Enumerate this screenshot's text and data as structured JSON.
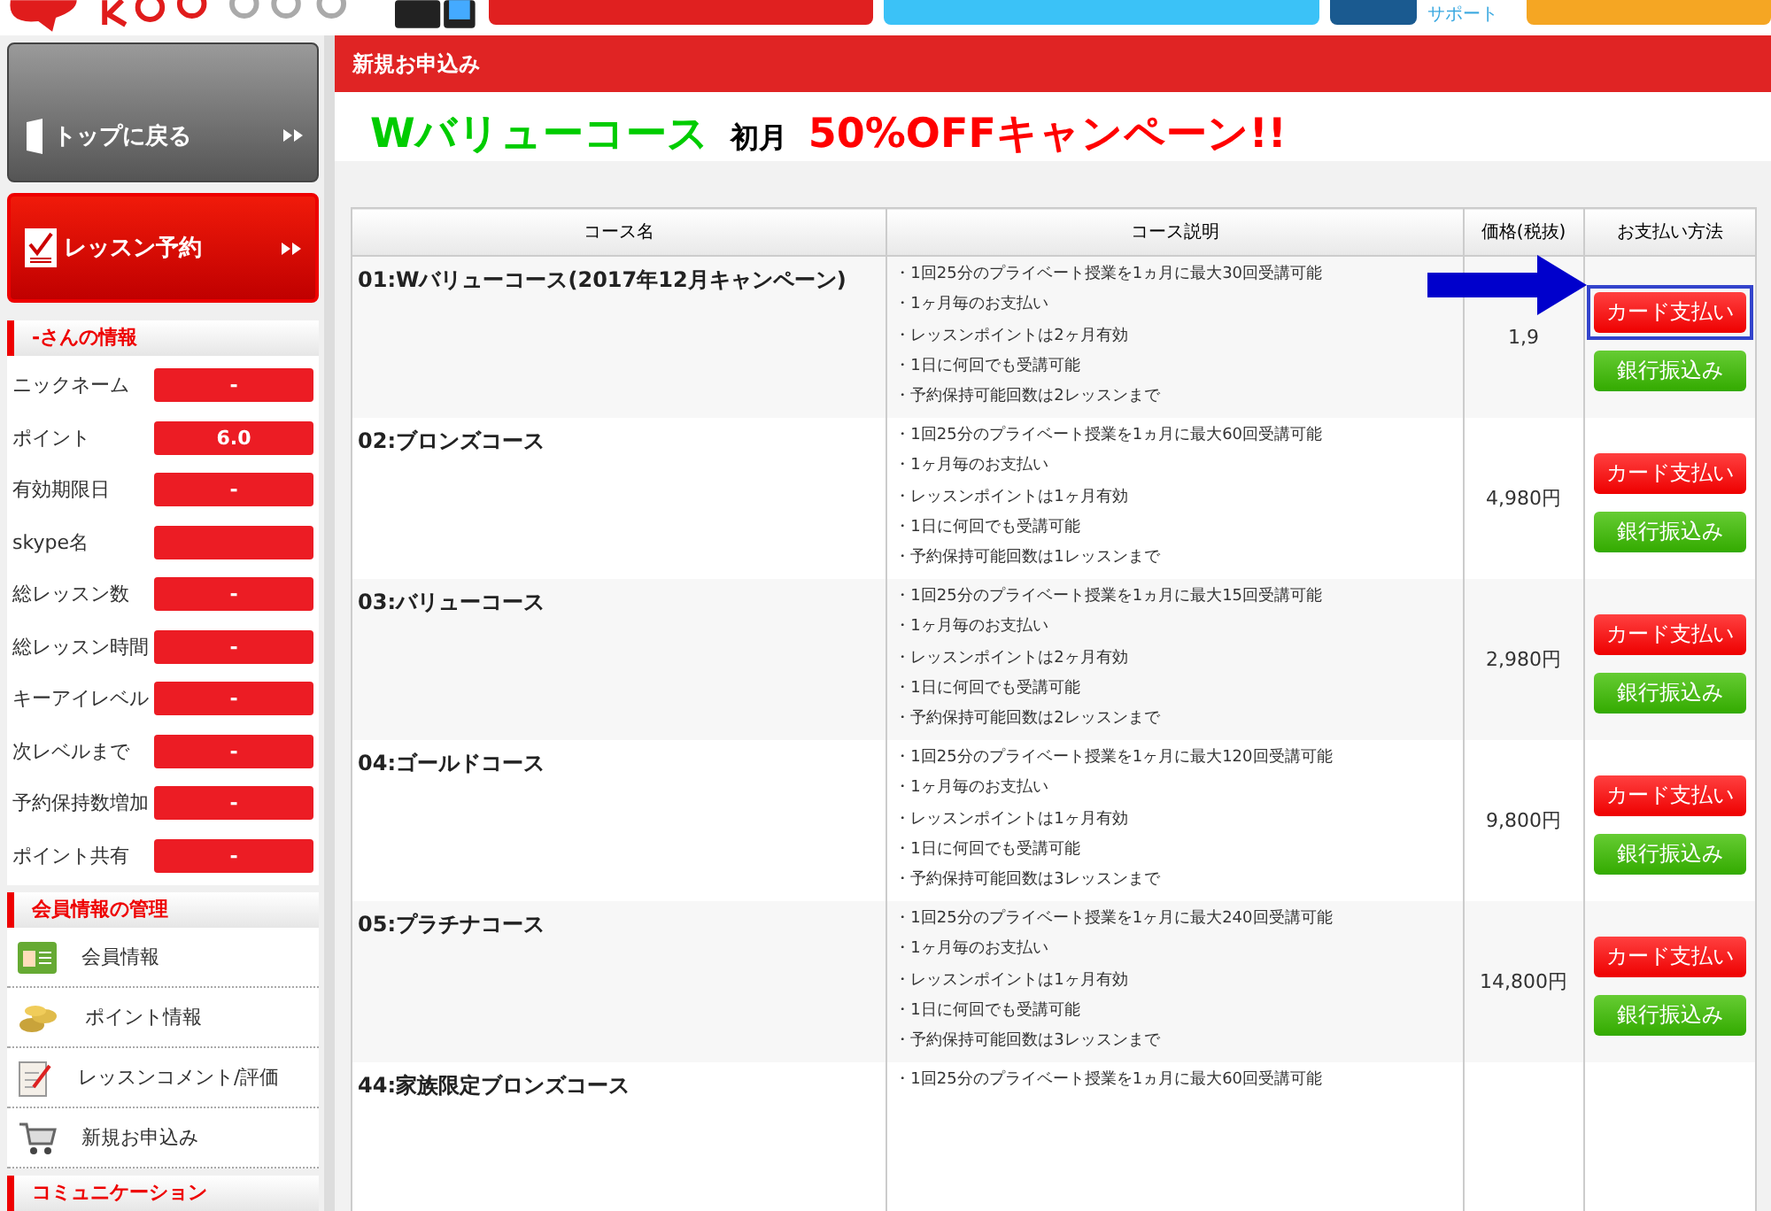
{
  "header": {
    "support_label": "サポート"
  },
  "sidebar": {
    "buttons": [
      {
        "label": "トップに戻る",
        "kind": "gray"
      },
      {
        "label": "レッスン予約",
        "kind": "red"
      }
    ],
    "info": {
      "title": "-さんの情報",
      "rows": [
        {
          "label": "ニックネーム",
          "value": "-"
        },
        {
          "label": "ポイント",
          "value": "6.0"
        },
        {
          "label": "有効期限日",
          "value": "-"
        },
        {
          "label": "skype名",
          "value": ""
        },
        {
          "label": "総レッスン数",
          "value": "-"
        },
        {
          "label": "総レッスン時間",
          "value": "-"
        },
        {
          "label": "キーアイレベル",
          "value": "-"
        },
        {
          "label": "次レベルまで",
          "value": "-"
        },
        {
          "label": "予約保持数増加",
          "value": "-"
        },
        {
          "label": "ポイント共有",
          "value": "-"
        }
      ]
    },
    "manage": {
      "title": "会員情報の管理",
      "items": [
        {
          "label": "会員情報",
          "kind": "card"
        },
        {
          "label": "ポイント情報",
          "kind": "coins"
        },
        {
          "label": "レッスンコメント/評価",
          "kind": "memo"
        },
        {
          "label": "新規お申込み",
          "kind": "cart"
        }
      ]
    },
    "communication": {
      "title": "コミュニケーション"
    }
  },
  "main": {
    "bar_title": "新規お申込み",
    "headline": {
      "course": "Wバリューコース",
      "month": "初月",
      "offer": "50%OFFキャンペーン!!"
    },
    "table": {
      "columns": [
        "コース名",
        "コース説明",
        "価格(税抜)",
        "お支払い方法"
      ],
      "rows": [
        {
          "name": "01:Wバリューコース(2017年12月キャンペーン)",
          "lines": [
            "・1回25分のプライベート授業を1ヵ月に最大30回受講可能",
            "・1ヶ月毎のお支払い",
            "・レッスンポイントは2ヶ月有効",
            "・1日に何回でも受講可能",
            "・予約保持可能回数は2レッスンまで"
          ],
          "price": "1,9",
          "card": "カード支払い",
          "bank": "銀行振込み",
          "highlighted": true
        },
        {
          "name": "02:ブロンズコース",
          "lines": [
            "・1回25分のプライベート授業を1ヵ月に最大60回受講可能",
            "・1ヶ月毎のお支払い",
            "・レッスンポイントは1ヶ月有効",
            "・1日に何回でも受講可能",
            "・予約保持可能回数は1レッスンまで"
          ],
          "price": "4,980円",
          "card": "カード支払い",
          "bank": "銀行振込み",
          "highlighted": false
        },
        {
          "name": "03:バリューコース",
          "lines": [
            "・1回25分のプライベート授業を1ヵ月に最大15回受講可能",
            "・1ヶ月毎のお支払い",
            "・レッスンポイントは2ヶ月有効",
            "・1日に何回でも受講可能",
            "・予約保持可能回数は2レッスンまで"
          ],
          "price": "2,980円",
          "card": "カード支払い",
          "bank": "銀行振込み",
          "highlighted": false
        },
        {
          "name": "04:ゴールドコース",
          "lines": [
            "・1回25分のプライベート授業を1ヶ月に最大120回受講可能",
            "・1ヶ月毎のお支払い",
            "・レッスンポイントは1ヶ月有効",
            "・1日に何回でも受講可能",
            "・予約保持可能回数は3レッスンまで"
          ],
          "price": "9,800円",
          "card": "カード支払い",
          "bank": "銀行振込み",
          "highlighted": false
        },
        {
          "name": "05:プラチナコース",
          "lines": [
            "・1回25分のプライベート授業を1ヶ月に最大240回受講可能",
            "・1ヶ月毎のお支払い",
            "・レッスンポイントは1ヶ月有効",
            "・1日に何回でも受講可能",
            "・予約保持可能回数は3レッスンまで"
          ],
          "price": "14,800円",
          "card": "カード支払い",
          "bank": "銀行振込み",
          "highlighted": false
        },
        {
          "name": "44:家族限定ブロンズコース",
          "lines": [
            "・1回25分のプライベート授業を1ヵ月に最大60回受講可能"
          ],
          "price": "",
          "card": "",
          "bank": "",
          "highlighted": false
        }
      ]
    }
  }
}
